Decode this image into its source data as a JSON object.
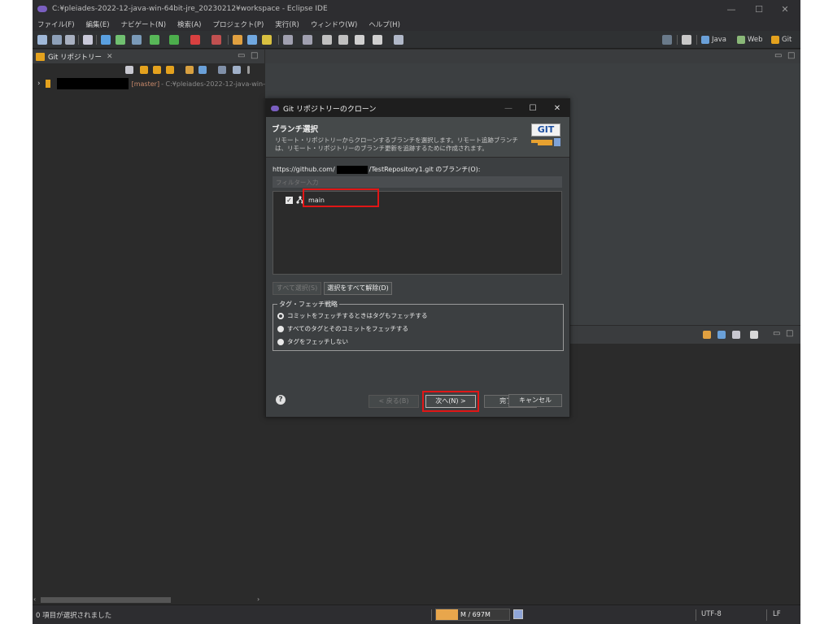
{
  "window": {
    "title": "C:¥pleiades-2022-12-java-win-64bit-jre_20230212¥workspace - Eclipse IDE",
    "minimize": "—",
    "maximize": "☐",
    "close": "✕"
  },
  "menu": [
    "ファイル(F)",
    "編集(E)",
    "ナビゲート(N)",
    "検索(A)",
    "プロジェクト(P)",
    "実行(R)",
    "ウィンドウ(W)",
    "ヘルプ(H)"
  ],
  "perspectives": {
    "java": "Java",
    "web": "Web",
    "git": "Git"
  },
  "left_view": {
    "tab_label": "Git リポジトリー",
    "tab_close": "✕",
    "repo": {
      "branch": "[master]",
      "path": "- C:¥pleiades-2022-12-java-win-64bit-"
    }
  },
  "status": {
    "selection": "0 項目が選択されました",
    "heap": "M / 697M",
    "heap_fraction": 0.3,
    "encoding": "UTF-8",
    "line_ending": "LF"
  },
  "dialog": {
    "title": "Git リポジトリーのクローン",
    "header_title": "ブランチ選択",
    "header_desc": "リモート・リポジトリーからクローンするブランチを選択します。リモート追跡ブランチは、リモート・リポジトリーのブランチ更新を追跡するために作成されます。",
    "branches_prefix": "https://github.com/",
    "branches_suffix": "/TestRepository1.git のブランチ(O):",
    "filter_placeholder": "フィルター入力",
    "branches": [
      {
        "name": "main",
        "checked": true
      }
    ],
    "select_all": "すべて選択(S)",
    "deselect_all": "選択をすべて解除(D)",
    "tag_group_label": "タグ・フェッチ戦略",
    "tag_options": [
      "コミットをフェッチするときはタグもフェッチする",
      "すべてのタグとそのコミットをフェッチする",
      "タグをフェッチしない"
    ],
    "help": "?",
    "back": "< 戻る(B)",
    "next": "次へ(N) >",
    "finish": "完了(F)",
    "cancel": "キャンセル"
  },
  "colors": {
    "highlight": "#e11616",
    "heap_fill": "#e8a64c",
    "git_orange": "#e4a21e"
  }
}
